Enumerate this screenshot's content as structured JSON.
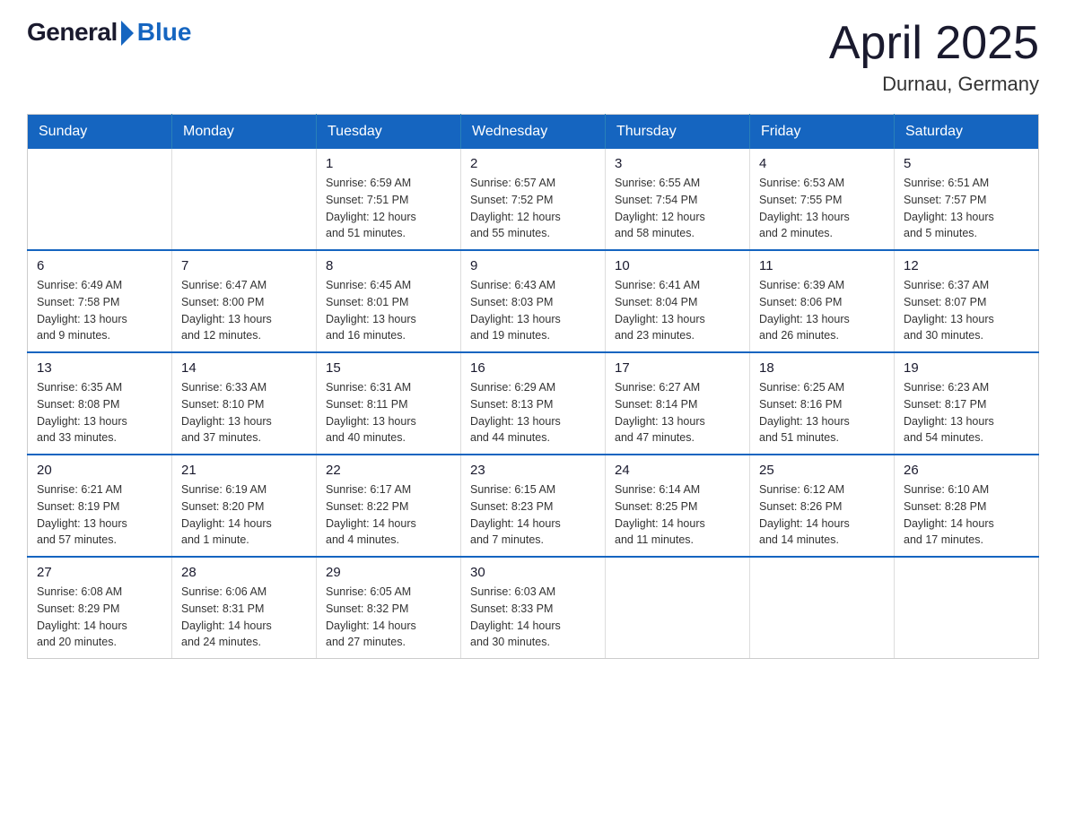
{
  "header": {
    "logo_general": "General",
    "logo_blue": "Blue",
    "month_title": "April 2025",
    "location": "Durnau, Germany"
  },
  "calendar": {
    "days_of_week": [
      "Sunday",
      "Monday",
      "Tuesday",
      "Wednesday",
      "Thursday",
      "Friday",
      "Saturday"
    ],
    "weeks": [
      [
        {
          "day": "",
          "info": ""
        },
        {
          "day": "",
          "info": ""
        },
        {
          "day": "1",
          "info": "Sunrise: 6:59 AM\nSunset: 7:51 PM\nDaylight: 12 hours\nand 51 minutes."
        },
        {
          "day": "2",
          "info": "Sunrise: 6:57 AM\nSunset: 7:52 PM\nDaylight: 12 hours\nand 55 minutes."
        },
        {
          "day": "3",
          "info": "Sunrise: 6:55 AM\nSunset: 7:54 PM\nDaylight: 12 hours\nand 58 minutes."
        },
        {
          "day": "4",
          "info": "Sunrise: 6:53 AM\nSunset: 7:55 PM\nDaylight: 13 hours\nand 2 minutes."
        },
        {
          "day": "5",
          "info": "Sunrise: 6:51 AM\nSunset: 7:57 PM\nDaylight: 13 hours\nand 5 minutes."
        }
      ],
      [
        {
          "day": "6",
          "info": "Sunrise: 6:49 AM\nSunset: 7:58 PM\nDaylight: 13 hours\nand 9 minutes."
        },
        {
          "day": "7",
          "info": "Sunrise: 6:47 AM\nSunset: 8:00 PM\nDaylight: 13 hours\nand 12 minutes."
        },
        {
          "day": "8",
          "info": "Sunrise: 6:45 AM\nSunset: 8:01 PM\nDaylight: 13 hours\nand 16 minutes."
        },
        {
          "day": "9",
          "info": "Sunrise: 6:43 AM\nSunset: 8:03 PM\nDaylight: 13 hours\nand 19 minutes."
        },
        {
          "day": "10",
          "info": "Sunrise: 6:41 AM\nSunset: 8:04 PM\nDaylight: 13 hours\nand 23 minutes."
        },
        {
          "day": "11",
          "info": "Sunrise: 6:39 AM\nSunset: 8:06 PM\nDaylight: 13 hours\nand 26 minutes."
        },
        {
          "day": "12",
          "info": "Sunrise: 6:37 AM\nSunset: 8:07 PM\nDaylight: 13 hours\nand 30 minutes."
        }
      ],
      [
        {
          "day": "13",
          "info": "Sunrise: 6:35 AM\nSunset: 8:08 PM\nDaylight: 13 hours\nand 33 minutes."
        },
        {
          "day": "14",
          "info": "Sunrise: 6:33 AM\nSunset: 8:10 PM\nDaylight: 13 hours\nand 37 minutes."
        },
        {
          "day": "15",
          "info": "Sunrise: 6:31 AM\nSunset: 8:11 PM\nDaylight: 13 hours\nand 40 minutes."
        },
        {
          "day": "16",
          "info": "Sunrise: 6:29 AM\nSunset: 8:13 PM\nDaylight: 13 hours\nand 44 minutes."
        },
        {
          "day": "17",
          "info": "Sunrise: 6:27 AM\nSunset: 8:14 PM\nDaylight: 13 hours\nand 47 minutes."
        },
        {
          "day": "18",
          "info": "Sunrise: 6:25 AM\nSunset: 8:16 PM\nDaylight: 13 hours\nand 51 minutes."
        },
        {
          "day": "19",
          "info": "Sunrise: 6:23 AM\nSunset: 8:17 PM\nDaylight: 13 hours\nand 54 minutes."
        }
      ],
      [
        {
          "day": "20",
          "info": "Sunrise: 6:21 AM\nSunset: 8:19 PM\nDaylight: 13 hours\nand 57 minutes."
        },
        {
          "day": "21",
          "info": "Sunrise: 6:19 AM\nSunset: 8:20 PM\nDaylight: 14 hours\nand 1 minute."
        },
        {
          "day": "22",
          "info": "Sunrise: 6:17 AM\nSunset: 8:22 PM\nDaylight: 14 hours\nand 4 minutes."
        },
        {
          "day": "23",
          "info": "Sunrise: 6:15 AM\nSunset: 8:23 PM\nDaylight: 14 hours\nand 7 minutes."
        },
        {
          "day": "24",
          "info": "Sunrise: 6:14 AM\nSunset: 8:25 PM\nDaylight: 14 hours\nand 11 minutes."
        },
        {
          "day": "25",
          "info": "Sunrise: 6:12 AM\nSunset: 8:26 PM\nDaylight: 14 hours\nand 14 minutes."
        },
        {
          "day": "26",
          "info": "Sunrise: 6:10 AM\nSunset: 8:28 PM\nDaylight: 14 hours\nand 17 minutes."
        }
      ],
      [
        {
          "day": "27",
          "info": "Sunrise: 6:08 AM\nSunset: 8:29 PM\nDaylight: 14 hours\nand 20 minutes."
        },
        {
          "day": "28",
          "info": "Sunrise: 6:06 AM\nSunset: 8:31 PM\nDaylight: 14 hours\nand 24 minutes."
        },
        {
          "day": "29",
          "info": "Sunrise: 6:05 AM\nSunset: 8:32 PM\nDaylight: 14 hours\nand 27 minutes."
        },
        {
          "day": "30",
          "info": "Sunrise: 6:03 AM\nSunset: 8:33 PM\nDaylight: 14 hours\nand 30 minutes."
        },
        {
          "day": "",
          "info": ""
        },
        {
          "day": "",
          "info": ""
        },
        {
          "day": "",
          "info": ""
        }
      ]
    ]
  }
}
